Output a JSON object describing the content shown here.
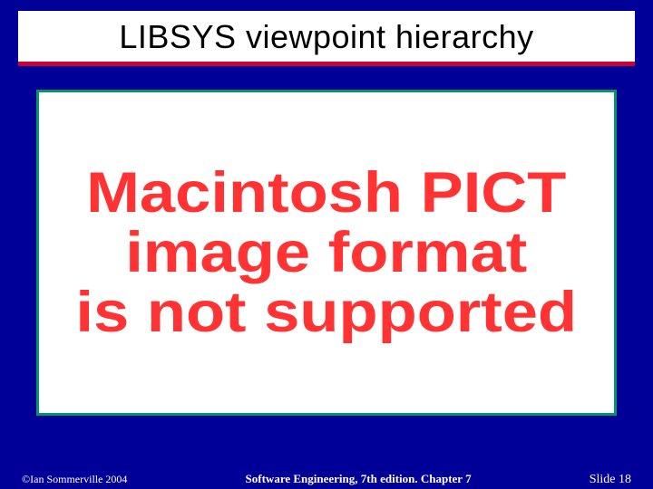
{
  "header": {
    "title": "LIBSYS viewpoint hierarchy"
  },
  "content": {
    "error_line1": "Macintosh PICT",
    "error_line2": "image format",
    "error_line3": "is not supported"
  },
  "footer": {
    "copyright": "©Ian Sommerville 2004",
    "center": "Software Engineering, 7th edition. Chapter 7",
    "slide_label": "Slide 18"
  }
}
